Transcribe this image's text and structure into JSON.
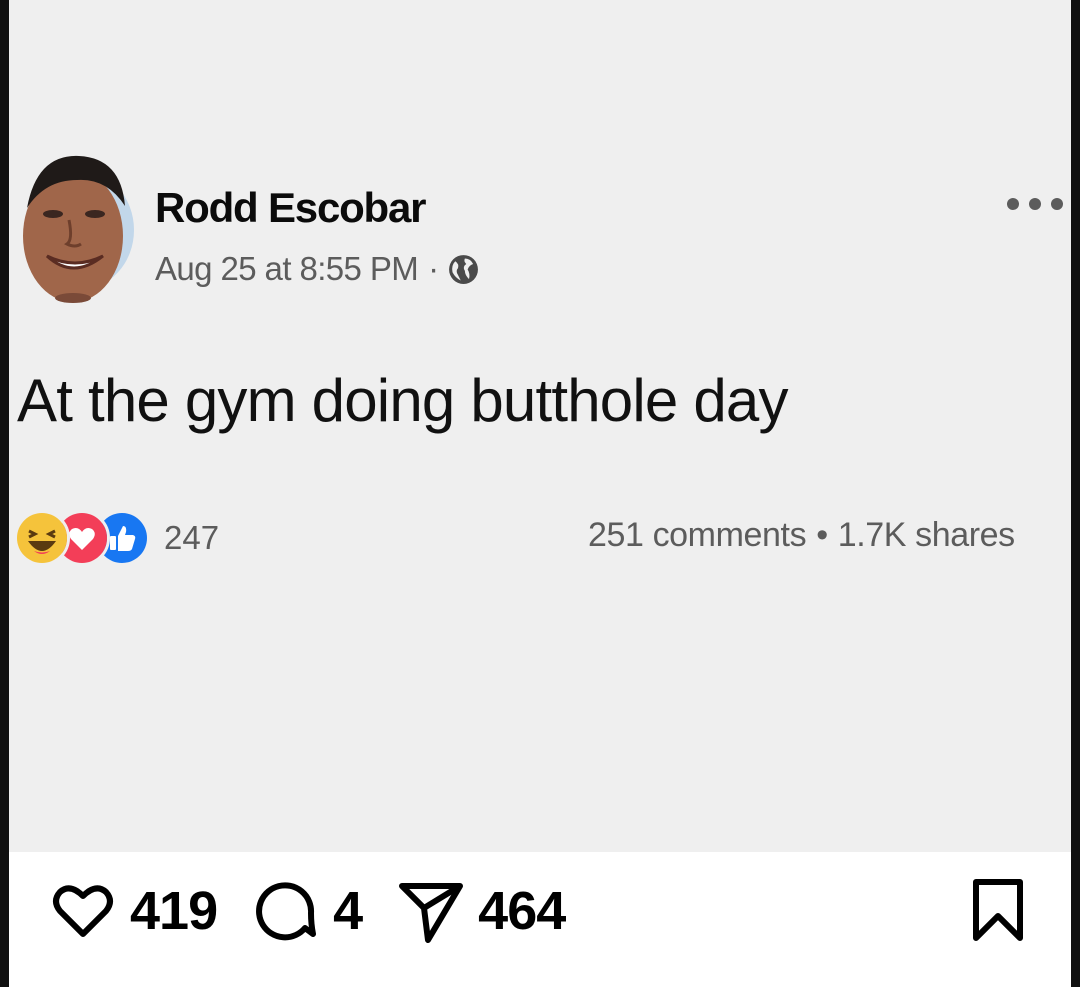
{
  "post": {
    "author": "Rodd Escobar",
    "timestamp": "Aug 25 at 8:55 PM",
    "separator": "·",
    "privacy_icon": "globe-icon",
    "more_icon": "more-dots-icon",
    "text": "At the gym doing butthole day",
    "reactions": {
      "icons": [
        "haha-reaction-icon",
        "love-reaction-icon",
        "like-reaction-icon"
      ],
      "count": "247"
    },
    "comments": "251 comments",
    "stats_separator": "•",
    "shares": "1.7K shares"
  },
  "actions": {
    "likes": "419",
    "comments": "4",
    "shares": "464",
    "like_icon": "heart-icon",
    "comment_icon": "comment-icon",
    "share_icon": "send-icon",
    "save_icon": "bookmark-icon"
  },
  "colors": {
    "background": "#ffffff",
    "card": "#efefef",
    "text_primary": "#111111",
    "text_secondary": "#5c5c5c",
    "haha": "#f5c33b",
    "love": "#f33e58",
    "like": "#1877f2"
  }
}
